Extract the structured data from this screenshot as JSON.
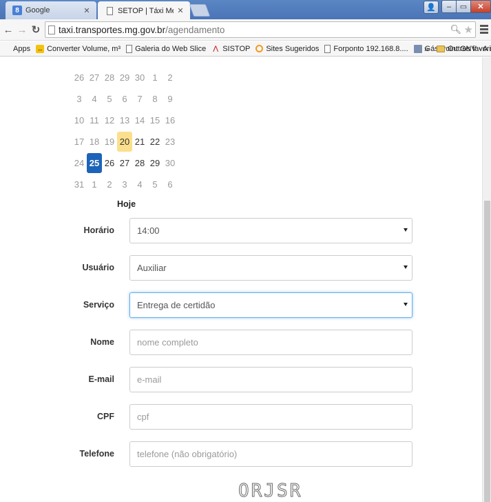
{
  "browser": {
    "tabs": [
      {
        "title": "Google",
        "favicon": "google-icon"
      },
      {
        "title": "SETOP | Táxi Metropolitan",
        "favicon": "page-icon"
      }
    ],
    "url_host": "taxi.transportes.mg.gov.br",
    "url_path": "/agendamento",
    "bookmarks": [
      {
        "label": "Apps",
        "icon": "apps-grid-icon"
      },
      {
        "label": "Converter Volume, m³",
        "icon": "converter-icon"
      },
      {
        "label": "Galeria do Web Slice",
        "icon": "page-icon"
      },
      {
        "label": "SISTOP",
        "icon": "sistop-icon"
      },
      {
        "label": "Sites Sugeridos",
        "icon": "suggested-sites-icon"
      },
      {
        "label": "Forponto 192.168.8....",
        "icon": "page-icon"
      },
      {
        "label": "Gás Point GNV - A e...",
        "icon": "gas-point-icon"
      }
    ],
    "more_bookmarks": "»",
    "other_bookmarks": "Outros favoritos"
  },
  "calendar": {
    "weeks": [
      [
        {
          "d": "26",
          "cur": false
        },
        {
          "d": "27",
          "cur": false
        },
        {
          "d": "28",
          "cur": false
        },
        {
          "d": "29",
          "cur": false
        },
        {
          "d": "30",
          "cur": false
        },
        {
          "d": "1",
          "cur": false
        },
        {
          "d": "2",
          "cur": false
        }
      ],
      [
        {
          "d": "3",
          "cur": false
        },
        {
          "d": "4",
          "cur": false
        },
        {
          "d": "5",
          "cur": false
        },
        {
          "d": "6",
          "cur": false
        },
        {
          "d": "7",
          "cur": false
        },
        {
          "d": "8",
          "cur": false
        },
        {
          "d": "9",
          "cur": false
        }
      ],
      [
        {
          "d": "10",
          "cur": false
        },
        {
          "d": "11",
          "cur": false
        },
        {
          "d": "12",
          "cur": false
        },
        {
          "d": "13",
          "cur": false
        },
        {
          "d": "14",
          "cur": false
        },
        {
          "d": "15",
          "cur": false
        },
        {
          "d": "16",
          "cur": false
        }
      ],
      [
        {
          "d": "17",
          "cur": false
        },
        {
          "d": "18",
          "cur": false
        },
        {
          "d": "19",
          "cur": false
        },
        {
          "d": "20",
          "cur": true,
          "today": true
        },
        {
          "d": "21",
          "cur": true
        },
        {
          "d": "22",
          "cur": true
        },
        {
          "d": "23",
          "cur": false
        }
      ],
      [
        {
          "d": "24",
          "cur": false
        },
        {
          "d": "25",
          "cur": true,
          "selected": true
        },
        {
          "d": "26",
          "cur": true
        },
        {
          "d": "27",
          "cur": true
        },
        {
          "d": "28",
          "cur": true
        },
        {
          "d": "29",
          "cur": true
        },
        {
          "d": "30",
          "cur": false
        }
      ],
      [
        {
          "d": "31",
          "cur": false
        },
        {
          "d": "1",
          "cur": false
        },
        {
          "d": "2",
          "cur": false
        },
        {
          "d": "3",
          "cur": false
        },
        {
          "d": "4",
          "cur": false
        },
        {
          "d": "5",
          "cur": false
        },
        {
          "d": "6",
          "cur": false
        }
      ]
    ],
    "today_label": "Hoje",
    "colors": {
      "today": "#fcdf8d",
      "selected": "#1d63b8"
    }
  },
  "form": {
    "horario": {
      "label": "Horário",
      "value": "14:00"
    },
    "usuario": {
      "label": "Usuário",
      "value": "Auxiliar"
    },
    "servico": {
      "label": "Serviço",
      "value": "Entrega de certidão"
    },
    "nome": {
      "label": "Nome",
      "placeholder": "nome completo"
    },
    "email": {
      "label": "E-mail",
      "placeholder": "e-mail"
    },
    "cpf": {
      "label": "CPF",
      "placeholder": "cpf"
    },
    "telefone": {
      "label": "Telefone",
      "placeholder": "telefone (não obrigatório)"
    }
  },
  "captcha": {
    "text": "ORJSR"
  }
}
